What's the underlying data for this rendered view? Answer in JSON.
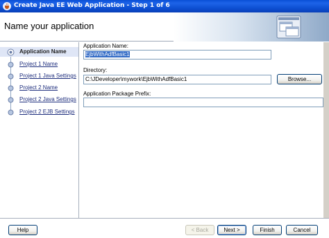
{
  "window": {
    "title": "Create Java EE Web Application - Step 1 of 6",
    "icon": "java-cup-icon"
  },
  "header": {
    "heading": "Name your application",
    "graphic_icon": "application-windows-icon"
  },
  "steps": [
    {
      "label": "Application Name",
      "active": true
    },
    {
      "label": "Project 1 Name",
      "active": false
    },
    {
      "label": "Project 1 Java Settings",
      "active": false
    },
    {
      "label": "Project 2 Name",
      "active": false
    },
    {
      "label": "Project 2 Java Settings",
      "active": false
    },
    {
      "label": "Project 2 EJB Settings",
      "active": false
    }
  ],
  "form": {
    "app_name_label": "Application Name:",
    "app_name_value": "EjbWithAdfBasic1",
    "directory_label": "Directory:",
    "directory_value": "C:\\JDeveloper\\mywork\\EjbWithAdfBasic1",
    "browse_label": "Browse...",
    "package_prefix_label": "Application Package Prefix:",
    "package_prefix_value": ""
  },
  "footer": {
    "help_label": "Help",
    "back_label": "< Back",
    "next_label": "Next >",
    "finish_label": "Finish",
    "cancel_label": "Cancel"
  }
}
